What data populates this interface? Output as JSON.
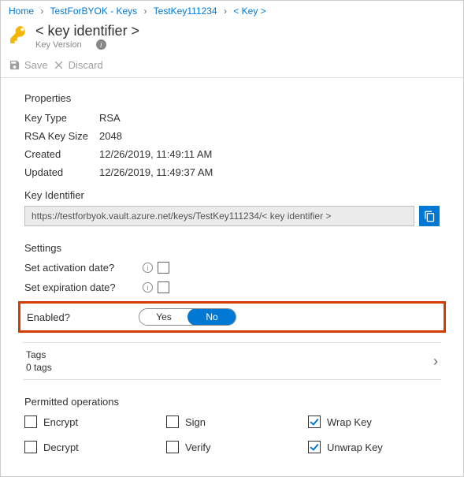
{
  "breadcrumb": {
    "home": "Home",
    "vault": "TestForBYOK - Keys",
    "key": "TestKey111234",
    "version": "< Key >"
  },
  "header": {
    "title": "< key identifier >",
    "subtitle": "Key Version"
  },
  "toolbar": {
    "save": "Save",
    "discard": "Discard"
  },
  "props": {
    "heading": "Properties",
    "key_type_label": "Key Type",
    "key_type": "RSA",
    "key_size_label": "RSA Key Size",
    "key_size": "2048",
    "created_label": "Created",
    "created": "12/26/2019, 11:49:11 AM",
    "updated_label": "Updated",
    "updated": "12/26/2019, 11:49:37 AM",
    "identifier_label": "Key Identifier",
    "identifier": "https://testforbyok.vault.azure.net/keys/TestKey111234/< key identifier >"
  },
  "settings": {
    "heading": "Settings",
    "activation_label": "Set activation date?",
    "expiration_label": "Set expiration date?",
    "enabled_label": "Enabled?",
    "enabled_yes": "Yes",
    "enabled_no": "No"
  },
  "tags": {
    "label": "Tags",
    "count": "0 tags"
  },
  "perms": {
    "heading": "Permitted operations",
    "items": [
      {
        "label": "Encrypt",
        "checked": false
      },
      {
        "label": "Sign",
        "checked": false
      },
      {
        "label": "Wrap Key",
        "checked": true
      },
      {
        "label": "Decrypt",
        "checked": false
      },
      {
        "label": "Verify",
        "checked": false
      },
      {
        "label": "Unwrap Key",
        "checked": true
      }
    ]
  }
}
